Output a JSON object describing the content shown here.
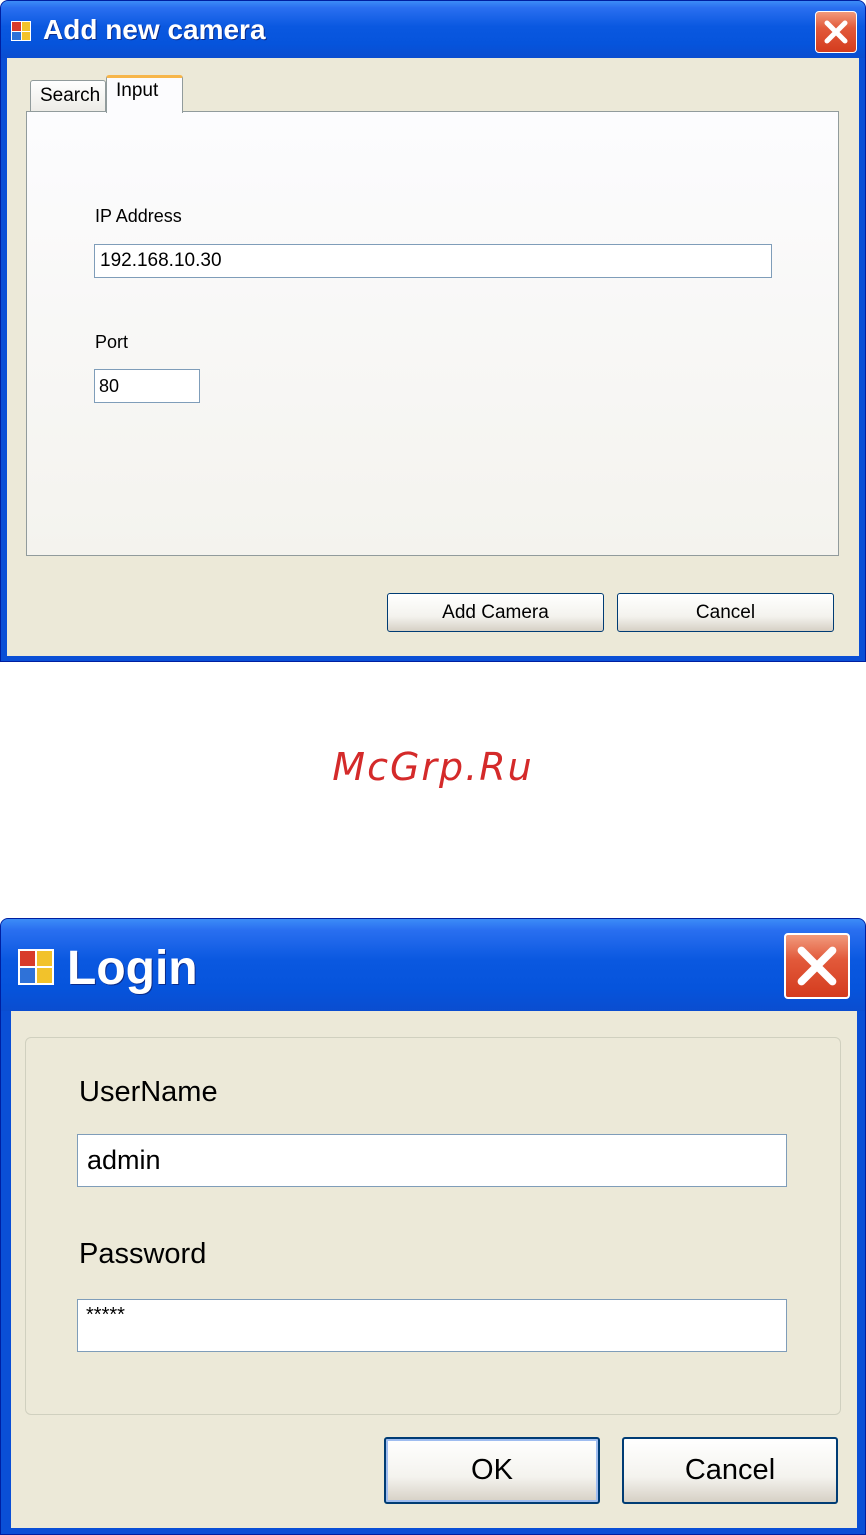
{
  "add_camera_dialog": {
    "title": "Add new camera",
    "tabs": [
      {
        "label": "Search",
        "selected": false
      },
      {
        "label": "Input",
        "selected": true
      }
    ],
    "ip_address": {
      "label": "IP Address",
      "value": "192.168.10.30"
    },
    "port": {
      "label": "Port",
      "value": "80"
    },
    "buttons": {
      "add": "Add Camera",
      "cancel": "Cancel"
    }
  },
  "watermark": "McGrp.Ru",
  "login_dialog": {
    "title": "Login",
    "username": {
      "label": "UserName",
      "value": "admin"
    },
    "password": {
      "label": "Password",
      "value": "*****"
    },
    "buttons": {
      "ok": "OK",
      "cancel": "Cancel"
    }
  },
  "colors": {
    "title_bar": "#0a58e0",
    "window_border": "#0a4fd6",
    "dialog_face": "#ece9d8",
    "close_button": "#d43c1e",
    "tab_highlight": "#f7b64a",
    "watermark": "#d42a2a"
  },
  "icons": [
    "app-icon",
    "close-icon"
  ]
}
